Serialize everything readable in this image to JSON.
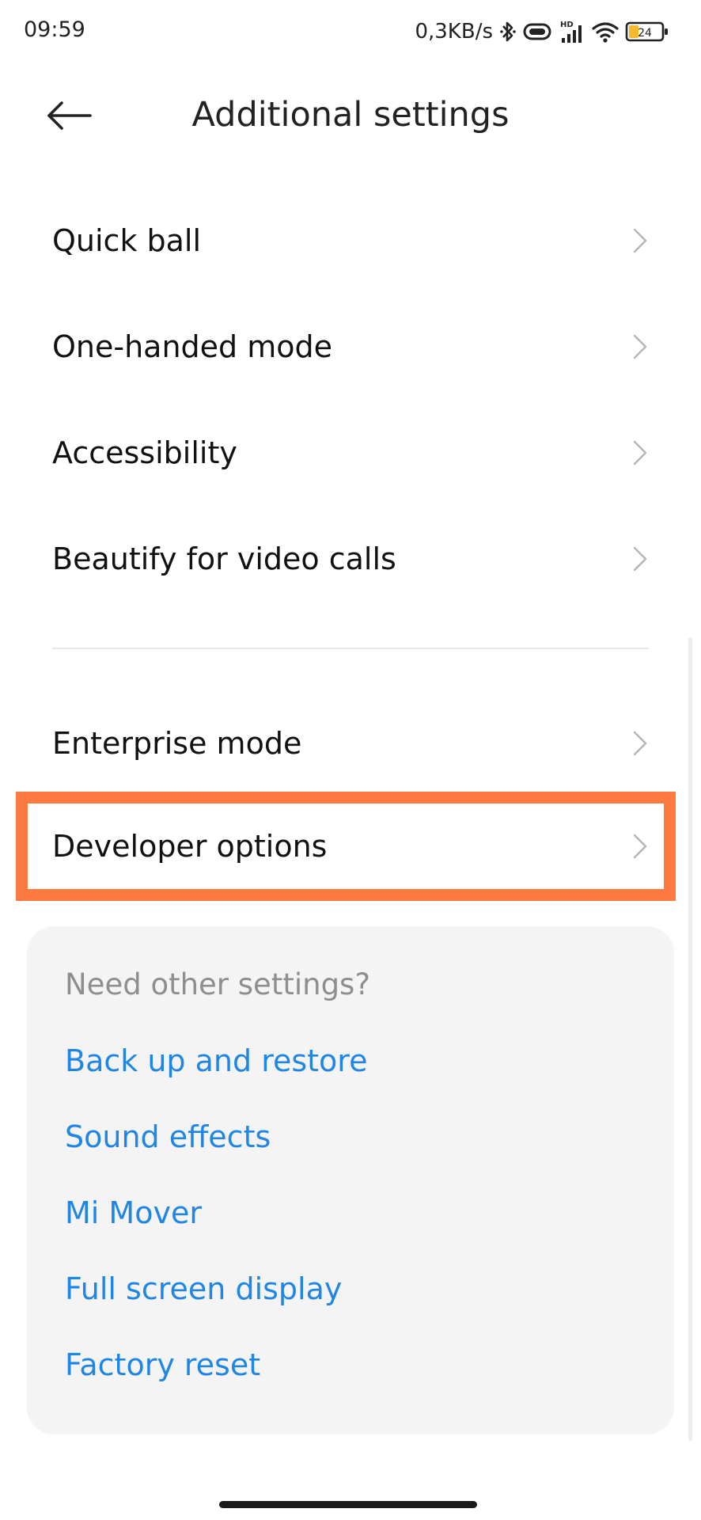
{
  "status_bar": {
    "time": "09:59",
    "speed": "0,3KB/s",
    "battery": "24",
    "icons": [
      "bluetooth-icon",
      "vibrate-icon",
      "hd-signal-icon",
      "wifi-icon",
      "battery-icon"
    ]
  },
  "header": {
    "title": "Additional settings",
    "back_icon": "back-arrow-icon"
  },
  "settings": {
    "items": [
      {
        "label": "Quick ball"
      },
      {
        "label": "One-handed mode"
      },
      {
        "label": "Accessibility"
      },
      {
        "label": "Beautify for video calls"
      },
      {
        "label": "Enterprise mode"
      },
      {
        "label": "Developer options"
      }
    ],
    "highlighted_item": "Developer options"
  },
  "suggestions": {
    "heading": "Need other settings?",
    "links": [
      {
        "label": "Back up and restore"
      },
      {
        "label": "Sound effects"
      },
      {
        "label": "Mi Mover"
      },
      {
        "label": "Full screen display"
      },
      {
        "label": "Factory reset"
      }
    ]
  },
  "colors": {
    "highlight": "#ff7a40",
    "link": "#1f86e4",
    "card_bg": "#f4f4f4",
    "battery_fill": "#f5b82e"
  }
}
